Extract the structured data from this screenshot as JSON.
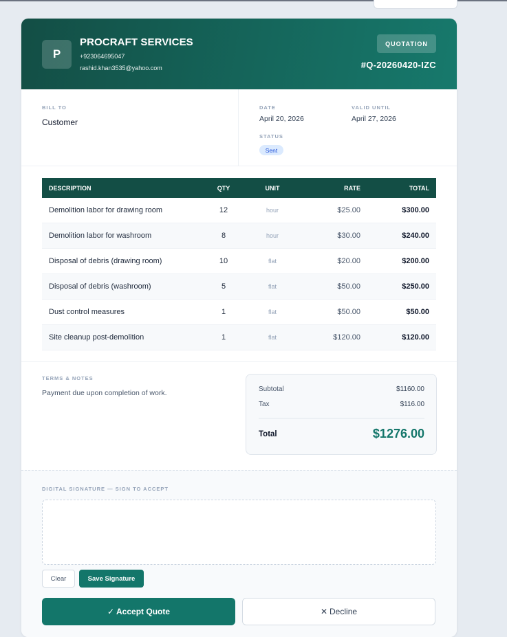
{
  "company": {
    "logo_letter": "P",
    "name": "PROCRAFT SERVICES",
    "phone": "+923064695047",
    "email": "rashid.khan3535@yahoo.com"
  },
  "quote": {
    "badge": "QUOTATION",
    "number": "#Q-20260420-IZC"
  },
  "bill_to": {
    "label": "BILL TO",
    "name": "Customer"
  },
  "meta": {
    "date_label": "DATE",
    "date": "April 20, 2026",
    "valid_label": "VALID UNTIL",
    "valid_until": "April 27, 2026",
    "status_label": "STATUS",
    "status": "Sent"
  },
  "table": {
    "headers": [
      "DESCRIPTION",
      "QTY",
      "UNIT",
      "RATE",
      "TOTAL"
    ],
    "rows": [
      {
        "description": "Demolition labor for drawing room",
        "qty": "12",
        "unit": "hour",
        "rate": "$25.00",
        "total": "$300.00"
      },
      {
        "description": "Demolition labor for washroom",
        "qty": "8",
        "unit": "hour",
        "rate": "$30.00",
        "total": "$240.00"
      },
      {
        "description": "Disposal of debris (drawing room)",
        "qty": "10",
        "unit": "flat",
        "rate": "$20.00",
        "total": "$200.00"
      },
      {
        "description": "Disposal of debris (washroom)",
        "qty": "5",
        "unit": "flat",
        "rate": "$50.00",
        "total": "$250.00"
      },
      {
        "description": "Dust control measures",
        "qty": "1",
        "unit": "flat",
        "rate": "$50.00",
        "total": "$50.00"
      },
      {
        "description": "Site cleanup post-demolition",
        "qty": "1",
        "unit": "flat",
        "rate": "$120.00",
        "total": "$120.00"
      }
    ]
  },
  "notes": {
    "label": "TERMS & NOTES",
    "text": "Payment due upon completion of work."
  },
  "totals": {
    "subtotal_label": "Subtotal",
    "subtotal": "$1160.00",
    "tax_label": "Tax",
    "tax": "$116.00",
    "total_label": "Total",
    "total": "$1276.00"
  },
  "signature": {
    "label": "DIGITAL SIGNATURE — SIGN TO ACCEPT",
    "clear_label": "Clear",
    "save_label": "Save Signature"
  },
  "actions": {
    "accept_icon": "✓",
    "accept_label": "Accept Quote",
    "decline_icon": "✕",
    "decline_label": "Decline"
  },
  "colors": {
    "brand": "#134e45",
    "accent": "#13766a",
    "status_bg": "#dbeafe",
    "status_text": "#1d4ed8"
  }
}
